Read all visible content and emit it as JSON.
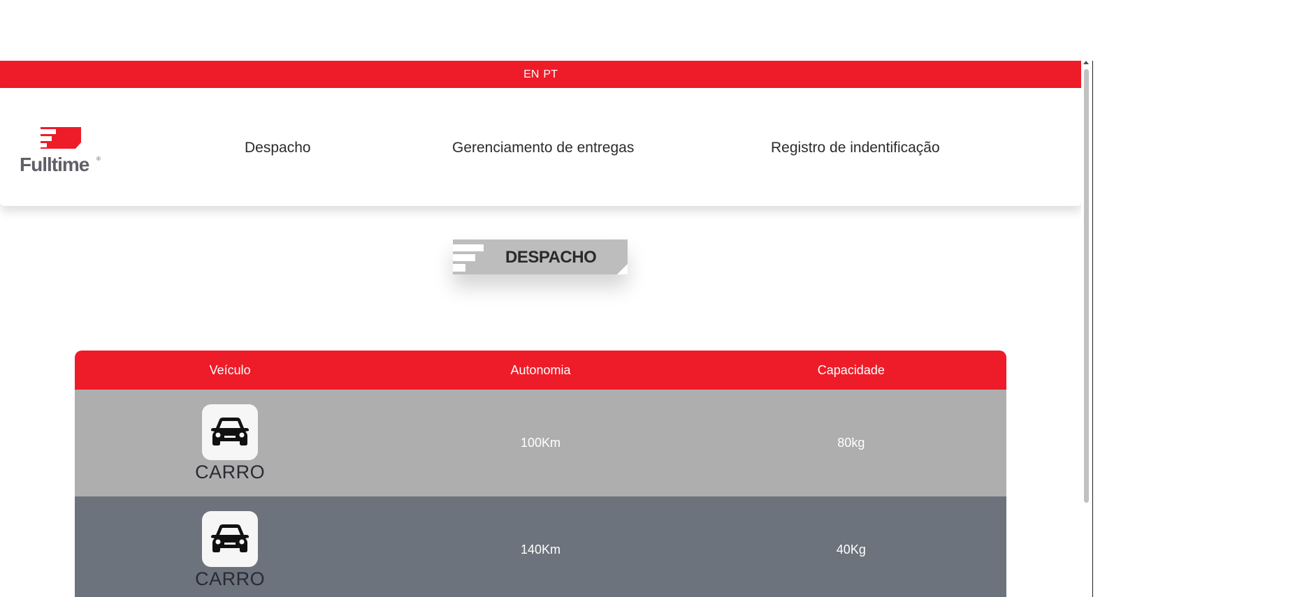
{
  "lang_bar": {
    "en": "EN",
    "pt": "PT"
  },
  "brand": {
    "logo_text": "Fulltime",
    "logo_mark": "®"
  },
  "nav": {
    "items": [
      {
        "label": "Despacho"
      },
      {
        "label": "Gerenciamento de entregas"
      },
      {
        "label": "Registro de indentificação"
      }
    ]
  },
  "page_badge": {
    "title": "DESPACHO"
  },
  "table": {
    "columns": [
      "Veículo",
      "Autonomia",
      "Capacidade"
    ],
    "rows": [
      {
        "vehicle": "CARRO",
        "icon": "car-icon",
        "autonomy": "100Km",
        "capacity": "80kg"
      },
      {
        "vehicle": "CARRO",
        "icon": "car-icon",
        "autonomy": "140Km",
        "capacity": "40Kg"
      }
    ]
  },
  "colors": {
    "brand_red": "#ee1c28",
    "row_light": "#afaeae",
    "row_dark": "#6c737c",
    "badge_gray": "#bdbdbd"
  }
}
